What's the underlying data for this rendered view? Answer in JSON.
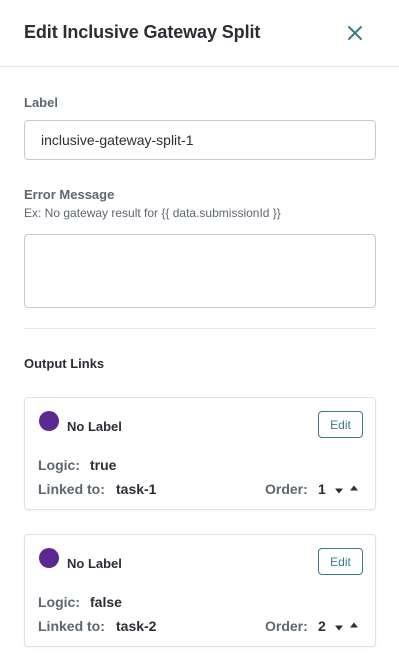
{
  "header": {
    "title": "Edit Inclusive Gateway Split",
    "close_icon": "close-icon"
  },
  "form": {
    "label_field": {
      "label": "Label",
      "value": "inclusive-gateway-split-1"
    },
    "error_message_field": {
      "label": "Error Message",
      "hint": "Ex: No gateway result for {{ data.submissionId }}",
      "value": ""
    }
  },
  "output_links": {
    "title": "Output Links",
    "dot_color": "#5b2a91",
    "accent_color": "#3c7a8a",
    "items": [
      {
        "name": "No Label",
        "edit_label": "Edit",
        "logic_label": "Logic:",
        "logic_value": "true",
        "linked_label": "Linked to:",
        "linked_value": "task-1",
        "order_label": "Order:",
        "order_value": "1"
      },
      {
        "name": "No Label",
        "edit_label": "Edit",
        "logic_label": "Logic:",
        "logic_value": "false",
        "linked_label": "Linked to:",
        "linked_value": "task-2",
        "order_label": "Order:",
        "order_value": "2"
      }
    ]
  }
}
